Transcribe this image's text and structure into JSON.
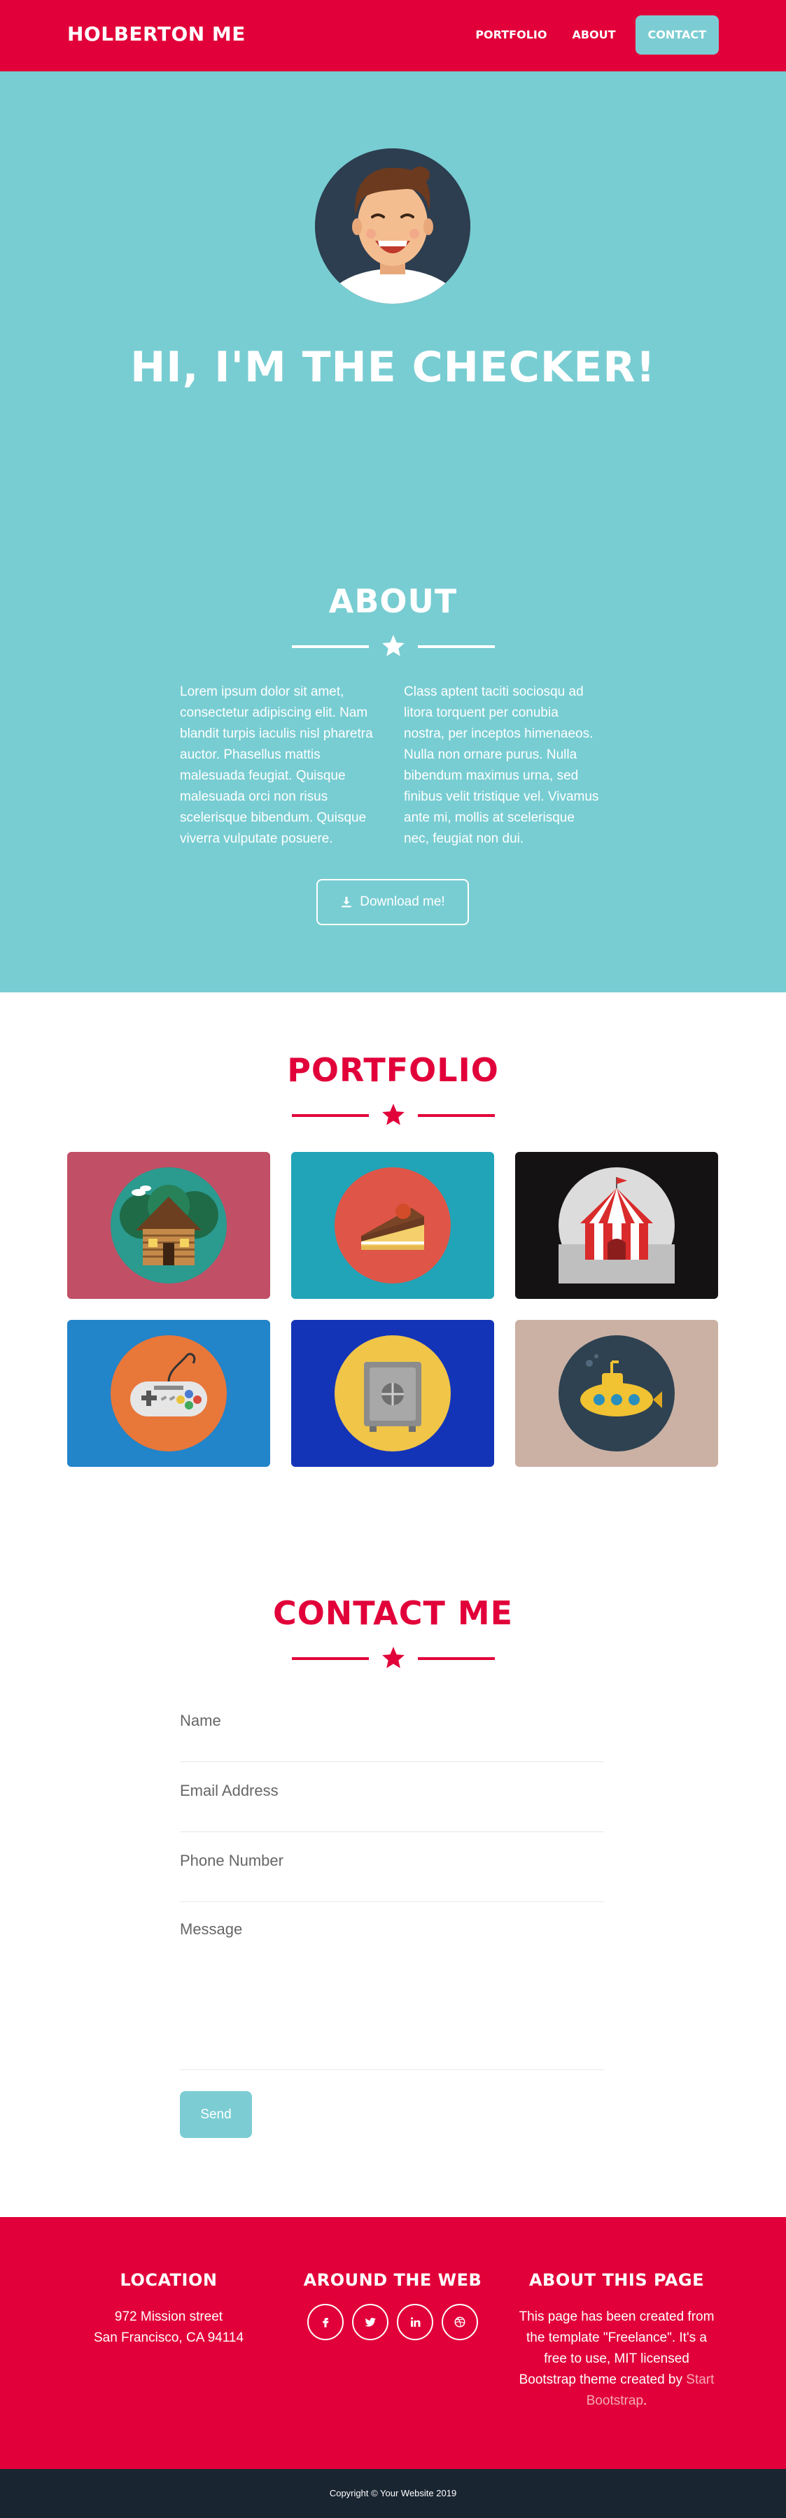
{
  "nav": {
    "brand": "HOLBERTON ME",
    "links": [
      "PORTFOLIO",
      "ABOUT",
      "CONTACT"
    ]
  },
  "hero": {
    "title": "HI, I'M THE CHECKER!"
  },
  "about": {
    "title": "ABOUT",
    "col1": "Lorem ipsum dolor sit amet, consectetur adipiscing elit. Nam blandit turpis iaculis nisl pharetra auctor. Phasellus mattis malesuada feugiat. Quisque malesuada orci non risus scelerisque bibendum. Quisque viverra vulputate posuere.",
    "col2": "Class aptent taciti sociosqu ad litora torquent per conubia nostra, per inceptos himenaeos. Nulla non ornare purus. Nulla bibendum maximus urna, sed finibus velit tristique vel. Vivamus ante mi, mollis at scelerisque nec, feugiat non dui.",
    "button": "Download me!"
  },
  "portfolio": {
    "title": "PORTFOLIO",
    "tiles": [
      {
        "icon": "cabin-icon",
        "bg": "#c14f65",
        "circle": "#2b9a8f"
      },
      {
        "icon": "cake-icon",
        "bg": "#21a4b8",
        "circle": "#df5547"
      },
      {
        "icon": "circus-tent-icon",
        "bg": "#151213",
        "circle": "#dcdcdc"
      },
      {
        "icon": "game-controller-icon",
        "bg": "#2284c9",
        "circle": "#e8773a"
      },
      {
        "icon": "safe-icon",
        "bg": "#1434b8",
        "circle": "#f0c548"
      },
      {
        "icon": "submarine-icon",
        "bg": "#cbb1a4",
        "circle": "#2e4251"
      }
    ]
  },
  "contact": {
    "title": "CONTACT ME",
    "fields": {
      "name": "Name",
      "email": "Email Address",
      "phone": "Phone Number",
      "message": "Message"
    },
    "send": "Send"
  },
  "footer": {
    "location_title": "LOCATION",
    "address1": "972 Mission street",
    "address2": "San Francisco, CA 94114",
    "web_title": "AROUND THE WEB",
    "socials": [
      "facebook-icon",
      "twitter-icon",
      "linkedin-icon",
      "dribbble-icon"
    ],
    "about_title": "ABOUT THIS PAGE",
    "about_text": "This page has been created from the template \"Freelance\". It's a free to use, MIT licensed Bootstrap theme created by",
    "about_link": "Start Bootstrap",
    "about_end": "."
  },
  "copyright": "Copyright © Your Website 2019",
  "colors": {
    "primary": "#e10039",
    "teal": "#78cdd2",
    "dark": "#1a2532"
  }
}
